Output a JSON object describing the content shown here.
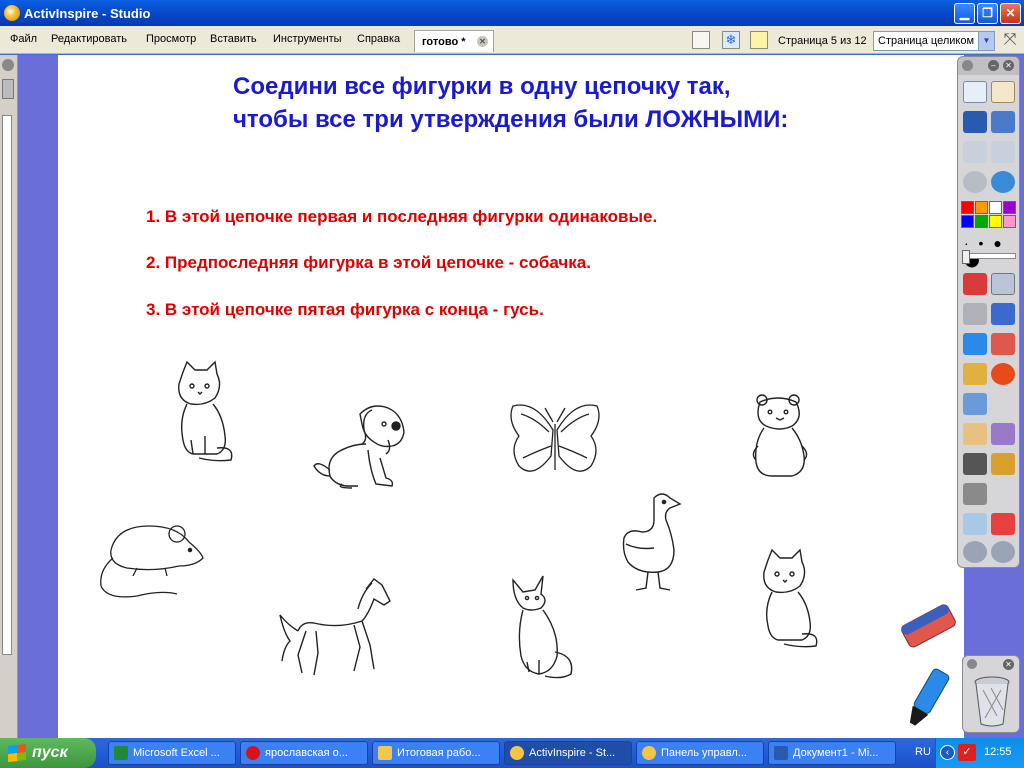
{
  "window": {
    "title": "ActivInspire - Studio"
  },
  "menu": [
    "Файл",
    "Редактировать",
    "Просмотр",
    "Вставить",
    "Инструменты",
    "Справка"
  ],
  "document_tab": {
    "label": "готово *"
  },
  "page_indicator": "Страница 5 из 12",
  "zoom": {
    "selected": "Страница целиком"
  },
  "page": {
    "heading_line1": "Соедини все фигурки в одну цепочку так,",
    "heading_line2": "чтобы все три утверждения были ЛОЖНЫМИ:",
    "statements": [
      "1. В этой цепочке первая и последняя фигурки одинаковые.",
      "2. Предпоследняя фигурка в этой цепочке - собачка.",
      "3. В этой цепочке пятая фигурка с конца -  гусь."
    ],
    "figures": [
      "kitten",
      "puppy",
      "butterfly",
      "bear",
      "mouse",
      "horse",
      "fox",
      "goose",
      "kitten"
    ]
  },
  "colors": {
    "heading": "#1a1ad0",
    "statement": "#e00000",
    "palette": [
      "#ff0000",
      "#ff9900",
      "#ffffff",
      "#9900cc",
      "#0000ff",
      "#00aa00",
      "#ffff00",
      "#ff99cc"
    ]
  },
  "taskbar": {
    "start_label": "пуск",
    "tasks": [
      {
        "label": "Microsoft Excel ...",
        "icon": "excel-icon"
      },
      {
        "label": "ярославская о...",
        "icon": "opera-icon"
      },
      {
        "label": "Итоговая рабо...",
        "icon": "folder-icon"
      },
      {
        "label": "ActivInspire - St...",
        "icon": "activinspire-icon"
      },
      {
        "label": "Панель управл...",
        "icon": "control-panel-icon"
      },
      {
        "label": "Документ1 - Mi...",
        "icon": "word-icon"
      }
    ],
    "language": "RU",
    "clock": "12:55"
  }
}
